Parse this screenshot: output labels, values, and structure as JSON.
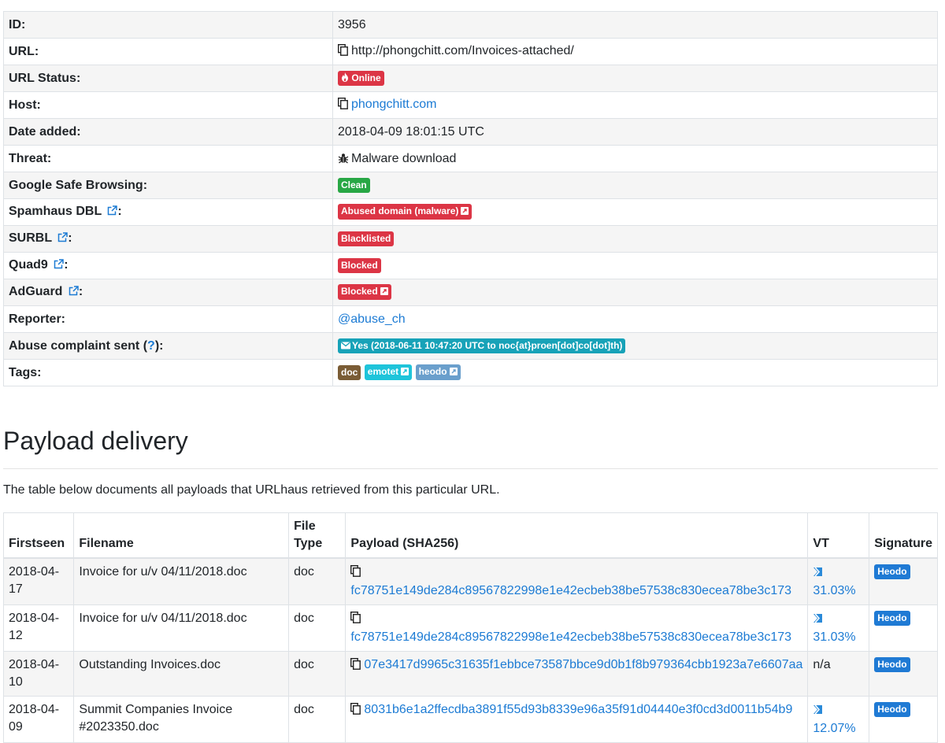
{
  "info": {
    "id_label": "ID:",
    "id_value": "3956",
    "url_label": "URL:",
    "url_value": "http://phongchitt.com/Invoices-attached/",
    "status_label": "URL Status:",
    "status_value": "Online",
    "host_label": "Host:",
    "host_value": "phongchitt.com",
    "date_label": "Date added:",
    "date_value": "2018-04-09 18:01:15 UTC",
    "threat_label": "Threat:",
    "threat_value": "Malware download",
    "gsb_label": "Google Safe Browsing:",
    "gsb_value": "Clean",
    "spamhaus_label": "Spamhaus DBL",
    "spamhaus_value": "Abused domain (malware)",
    "surbl_label": "SURBL",
    "surbl_value": "Blacklisted",
    "quad9_label": "Quad9",
    "quad9_value": "Blocked",
    "adguard_label": "AdGuard",
    "adguard_value": "Blocked",
    "reporter_label": "Reporter:",
    "reporter_value": "@abuse_ch",
    "abuse_label": "Abuse complaint sent (",
    "abuse_q": "?",
    "abuse_close": "):",
    "abuse_value": "Yes (2018-06-11 10:47:20 UTC to noc{at}proen[dot]co[dot]th)",
    "tags_label": "Tags:",
    "tags": [
      "doc",
      "emotet",
      "heodo"
    ],
    "colon": ":"
  },
  "payload": {
    "heading": "Payload delivery",
    "description": "The table below documents all payloads that URLhaus retrieved from this particular URL.",
    "columns": {
      "firstseen": "Firstseen",
      "filename": "Filename",
      "filetype_1": "File",
      "filetype_2": "Type",
      "payload": "Payload (SHA256)",
      "vt": "VT",
      "signature": "Signature"
    },
    "rows": [
      {
        "firstseen": "2018-04-17",
        "filename": "Invoice for u/v 04/11/2018.doc",
        "filetype": "doc",
        "hash": "fc78751e149de284c89567822998e1e42ecbeb38be57538c830ecea78be3c173",
        "vt": "31.03%",
        "signature": "Heodo"
      },
      {
        "firstseen": "2018-04-12",
        "filename": "Invoice for u/v 04/11/2018.doc",
        "filetype": "doc",
        "hash": "fc78751e149de284c89567822998e1e42ecbeb38be57538c830ecea78be3c173",
        "vt": "31.03%",
        "signature": "Heodo"
      },
      {
        "firstseen": "2018-04-10",
        "filename": "Outstanding Invoices.doc",
        "filetype": "doc",
        "hash": "07e3417d9965c31635f1ebbce73587bbce9d0b1f8b979364cbb1923a7e6607aa",
        "vt": "n/a",
        "signature": "Heodo"
      },
      {
        "firstseen": "2018-04-09",
        "filename_1": "Summit Companies Invoice",
        "filename_2": "#2023350.doc",
        "filetype": "doc",
        "hash": "8031b6e1a2ffecdba3891f55d93b8339e96a35f91d04440e3f0cd3d0011b54b9",
        "vt": "12.07%",
        "signature": "Heodo"
      }
    ]
  },
  "icons": {
    "copy": "copy-icon",
    "fire": "fire-icon",
    "bug": "bug-icon",
    "external": "external-link-icon",
    "envelope": "envelope-icon",
    "virustotal": "virustotal-icon"
  }
}
